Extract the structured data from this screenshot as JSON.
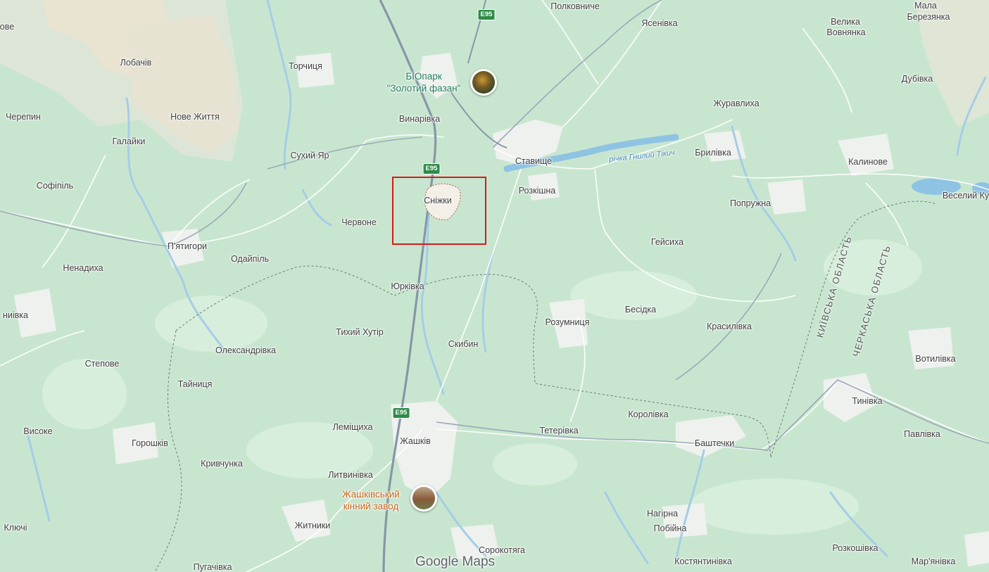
{
  "map": {
    "attribution": "Google Maps",
    "highlighted_place": "Сніжки",
    "road_shield": "E95",
    "river": "річка Гнилий Тікич",
    "regions": [
      "КИЇВСЬКА ОБЛАСТЬ",
      "ЧЕРКАСЬКА ОБЛАСТЬ"
    ],
    "poi": [
      {
        "line1": "БІОпарк",
        "line2": "\"Золотий фазан\"",
        "icon": "pheasant-photo"
      },
      {
        "line1": "Жашківський",
        "line2": "кінний завод",
        "icon": "horse-farm-photo"
      }
    ],
    "places": [
      "Полковниче",
      "Ясенівка",
      "Велика",
      "Вовнянка",
      "Мала",
      "Березянка",
      "Лобачів",
      "Торчиця",
      "Дубівка",
      "Черепин",
      "Нове Життя",
      "Винарівка",
      "Журавлиха",
      "Галайки",
      "Сухий Яр",
      "Ставище",
      "Брилівка",
      "Калинове",
      "Софіпіль",
      "Розкішна",
      "Попружна",
      "Веселий Ку",
      "Червоне",
      "Сніжки",
      "П'ятигори",
      "Одайпіль",
      "Гейсиха",
      "Ненадиха",
      "Юрківка",
      "Бесідка",
      "ниівка",
      "Розумниця",
      "Красилівка",
      "Тихий Хутір",
      "Скибин",
      "Олександрівка",
      "Степове",
      "Вотилівка",
      "Тайниця",
      "Тинівка",
      "Королівка",
      "Високе",
      "Леміщиха",
      "Тетерівка",
      "Горошків",
      "Жашків",
      "Баштечки",
      "Павлівка",
      "Кривчунка",
      "Литвинівка",
      "Нагірна",
      "Побійна",
      "Ключі",
      "Житники",
      "Сорокотяга",
      "Розкошівка",
      "Пугачівка",
      "Костянтинівка",
      "Мар'янівка",
      "ове"
    ]
  }
}
